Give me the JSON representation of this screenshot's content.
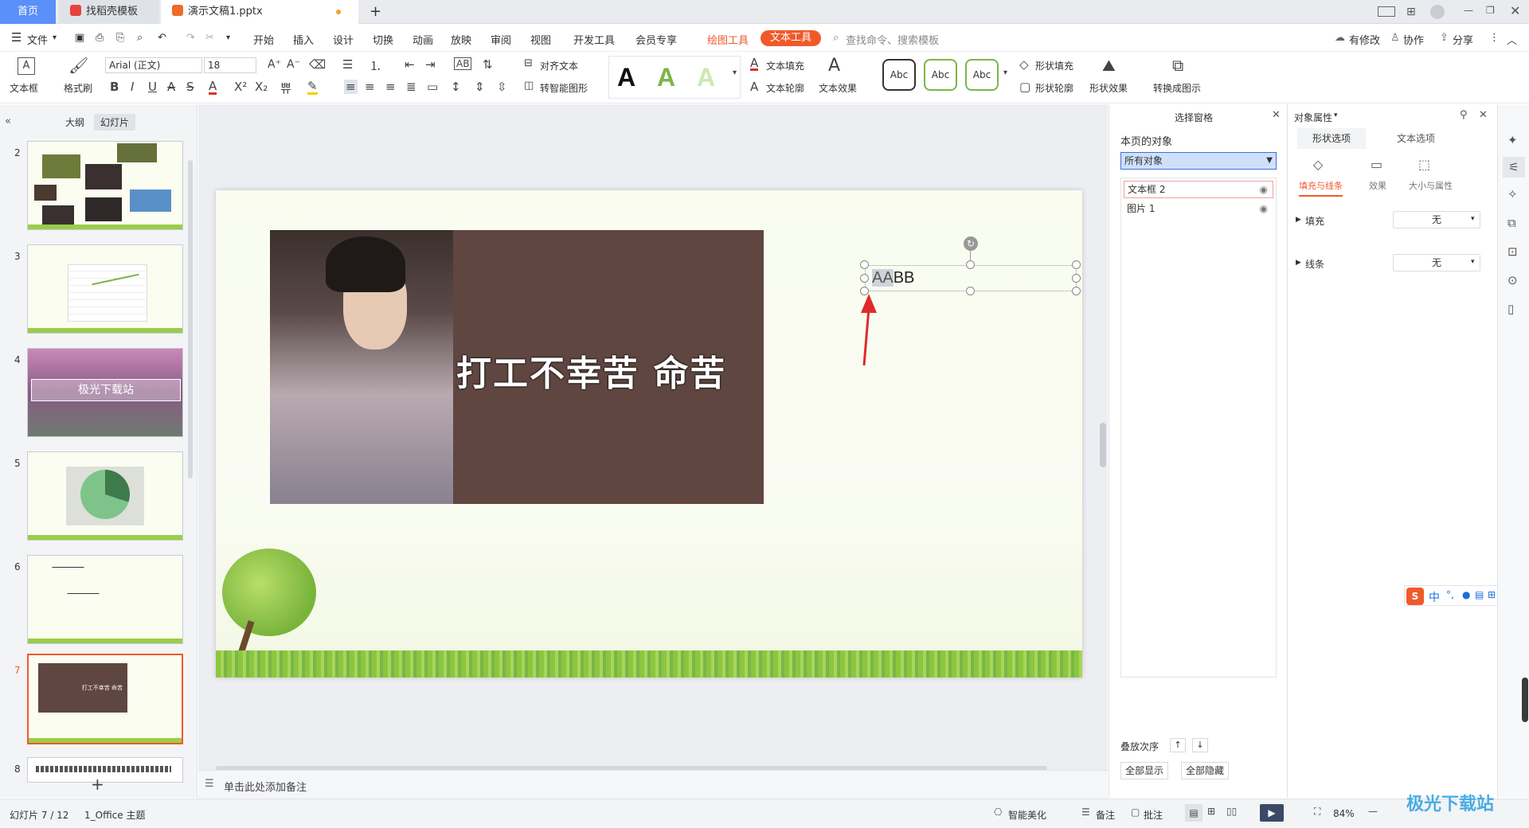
{
  "tabs": {
    "home": "首页",
    "template": "找稻壳模板",
    "doc": "演示文稿1.pptx",
    "add": "+"
  },
  "menu": {
    "file": "文件",
    "items": [
      "开始",
      "插入",
      "设计",
      "切换",
      "动画",
      "放映",
      "审阅",
      "视图",
      "开发工具",
      "会员专享"
    ],
    "drawing_tools": "绘图工具",
    "text_tools": "文本工具",
    "search": "查找命令、搜索模板",
    "modify": "有修改",
    "collab": "协作",
    "share": "分享"
  },
  "ribbon": {
    "textbox": "文本框",
    "format_painter": "格式刷",
    "font_name": "Arial (正文)",
    "font_size": "18",
    "align_text": "对齐文本",
    "smart_shape": "转智能图形",
    "text_fill": "文本填充",
    "text_outline": "文本轮廓",
    "text_effect": "文本效果",
    "style_a": "A",
    "abc": "Abc",
    "shape_fill": "形状填充",
    "shape_outline": "形状轮廓",
    "shape_effect": "形状效果",
    "convert_chart": "转换成图示"
  },
  "left": {
    "outline": "大纲",
    "slides": "幻灯片",
    "nums": [
      "2",
      "3",
      "4",
      "5",
      "6",
      "7",
      "8"
    ],
    "thumb4_text": "极光下载站",
    "thumb7_text": "打工不幸苦 命苦",
    "add": "+"
  },
  "slide": {
    "banner": "打工不幸苦 命苦",
    "textbox": "AABB",
    "textbox_hl": "AA",
    "textbox_rest": "BB"
  },
  "notes": {
    "placeholder": "单击此处添加备注"
  },
  "selection_pane": {
    "title": "选择窗格",
    "objects_label": "本页的对象",
    "filter": "所有对象",
    "items": [
      "文本框 2",
      "图片 1"
    ],
    "order_label": "叠放次序",
    "show_all": "全部显示",
    "hide_all": "全部隐藏"
  },
  "props": {
    "title": "对象属性",
    "tab_shape": "形状选项",
    "tab_text": "文本选项",
    "sub_fill": "填充与线条",
    "sub_effect": "效果",
    "sub_size": "大小与属性",
    "fill": "填充",
    "line": "线条",
    "none": "无"
  },
  "status": {
    "slide_pos": "幻灯片 7 / 12",
    "theme": "1_Office 主题",
    "beautify": "智能美化",
    "notes": "备注",
    "comments": "批注",
    "zoom": "84%"
  },
  "ime": {
    "lang": "中"
  },
  "watermark": "极光下载站",
  "colors": {
    "accent": "#f05a2a",
    "blue": "#5b8ff9",
    "banner_bg": "#5f4641"
  }
}
